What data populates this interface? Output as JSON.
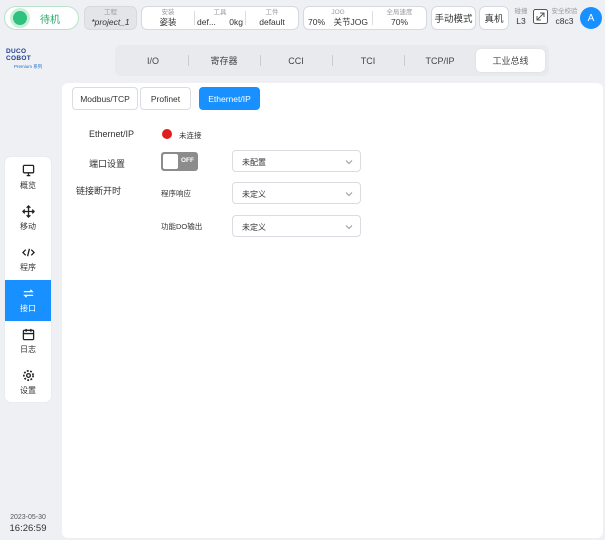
{
  "topbar": {
    "status": "待机",
    "project": {
      "label": "工程",
      "value": "*project_1"
    },
    "install": {
      "label": "安装",
      "value": "姿装"
    },
    "tool": {
      "label": "工具",
      "name": "def...",
      "weight": "0kg"
    },
    "workpiece": {
      "label": "工件",
      "value": "default"
    },
    "jog": {
      "label": "JOG",
      "percent": "70%",
      "mode": "关节JOG"
    },
    "global_speed": {
      "label": "全局速度",
      "value": "70%"
    },
    "manual_mode": "手动模式",
    "real_machine": "真机",
    "collision": {
      "label": "碰撞",
      "value": "L3"
    },
    "safety_check": {
      "label": "安全校验",
      "value": "c8c3"
    },
    "avatar": "A"
  },
  "logo": {
    "main": "DUCO COBOT",
    "sub": "Premium 系列"
  },
  "nav": {
    "items": [
      {
        "label": "概览",
        "icon": "monitor-icon"
      },
      {
        "label": "移动",
        "icon": "move-icon"
      },
      {
        "label": "程序",
        "icon": "code-icon"
      },
      {
        "label": "接口",
        "icon": "interface-icon",
        "active": true
      },
      {
        "label": "日志",
        "icon": "calendar-icon"
      },
      {
        "label": "设置",
        "icon": "gear-icon"
      }
    ]
  },
  "clock": {
    "date": "2023-05-30",
    "time": "16:26:59"
  },
  "tabs": [
    "I/O",
    "寄存器",
    "CCI",
    "TCI",
    "TCP/IP",
    "工业总线"
  ],
  "subtabs": [
    "Modbus/TCP",
    "Profinet",
    "Ethernet/IP"
  ],
  "form": {
    "ethernet_label": "Ethernet/IP",
    "connection_status": "未连接",
    "port_setting_label": "端口设置",
    "toggle_text": "OFF",
    "port_select": "未配置",
    "disconnect_label": "链接断开时",
    "program_response_label": "程序响应",
    "program_response_value": "未定义",
    "do_output_label": "功能DO输出",
    "do_output_value": "未定义"
  },
  "colors": {
    "accent": "#1890ff",
    "status_green": "#2ec27e",
    "error_red": "#e11c1c"
  }
}
